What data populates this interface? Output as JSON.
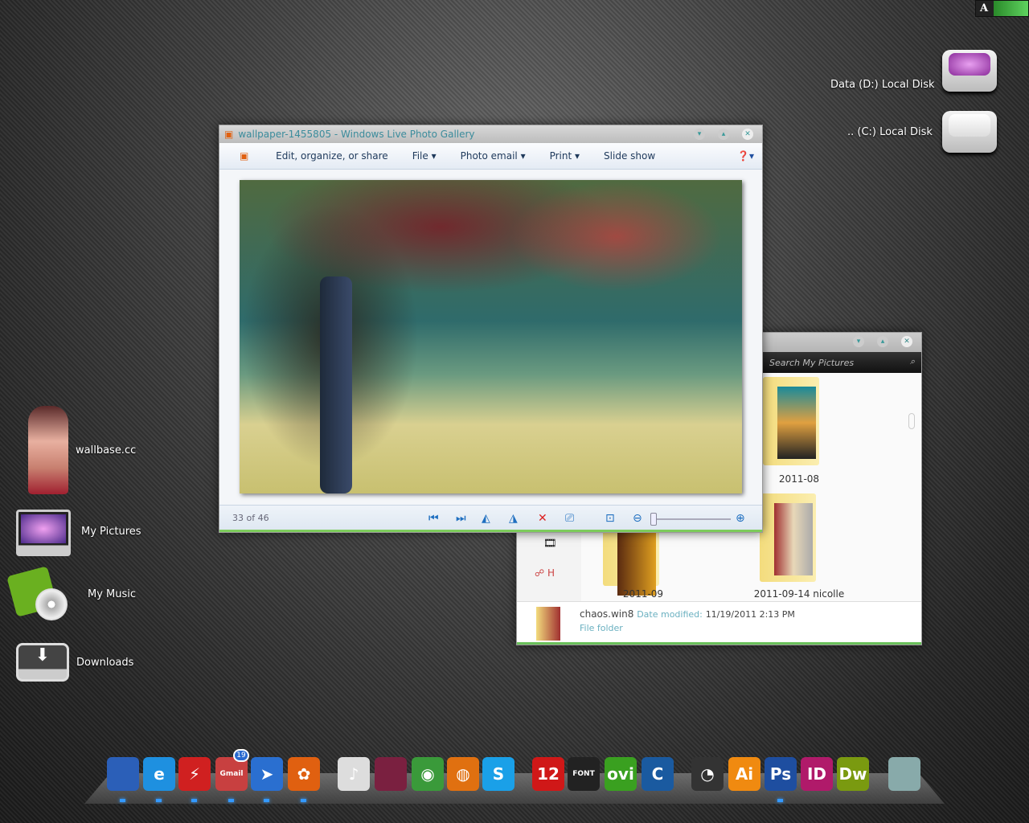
{
  "indicator": {
    "letter": "A",
    "color": "#4fc24f"
  },
  "desktop": {
    "right_icons": [
      {
        "label": "Data (D:) Local Disk",
        "icon": "drive-icon"
      },
      {
        "label": ".. (C:) Local Disk",
        "icon": "drive-icon"
      }
    ],
    "left_icons": [
      {
        "label": "wallbase.cc"
      },
      {
        "label": "My Pictures"
      },
      {
        "label": "My Music"
      },
      {
        "label": "Downloads"
      }
    ]
  },
  "photo_gallery": {
    "title": "wallpaper-1455805 - Windows Live Photo Gallery",
    "toolbar": [
      "Edit, organize, or share",
      "File ▾",
      "Photo email ▾",
      "Print ▾",
      "Slide show"
    ],
    "counter": "33 of 46",
    "zoom_level": 0.05
  },
  "explorer": {
    "search_placeholder": "Search My Pictures",
    "sidebar_partial": "H",
    "folders": [
      "2011-08",
      "2011-09",
      "2011-09-14 nicolle"
    ],
    "details": {
      "name": "chaos.win8",
      "date_label": "Date modified:",
      "date": "11/19/2011 2:13 PM",
      "type": "File folder"
    }
  },
  "dock": {
    "items": [
      {
        "name": "computer",
        "label": "",
        "color": "#2b5fb8"
      },
      {
        "name": "internet-explorer",
        "label": "e",
        "color": "#1e90e0"
      },
      {
        "name": "flashget",
        "label": "⚡",
        "color": "#d02020"
      },
      {
        "name": "gmail",
        "label": "Gmail",
        "color": "#c84040",
        "badge": "19"
      },
      {
        "name": "bird-app",
        "label": "➤",
        "color": "#2a6fd0"
      },
      {
        "name": "photo-gallery",
        "label": "✿",
        "color": "#e06010"
      },
      {
        "name": "mp3",
        "label": "♪",
        "color": "#ddd"
      },
      {
        "name": "photo-frame",
        "label": "",
        "color": "#7a2040"
      },
      {
        "name": "chrome",
        "label": "◉",
        "color": "#3a9a3a"
      },
      {
        "name": "firefox",
        "label": "◍",
        "color": "#e07010"
      },
      {
        "name": "skype",
        "label": "S",
        "color": "#1aa0e8"
      },
      {
        "name": "calendar",
        "label": "12",
        "color": "#d01818"
      },
      {
        "name": "font-book",
        "label": "FONT",
        "color": "#222"
      },
      {
        "name": "ovi",
        "label": "ovi",
        "color": "#3aa020"
      },
      {
        "name": "ccleaner",
        "label": "C",
        "color": "#1a5aa0"
      },
      {
        "name": "picasa",
        "label": "◔",
        "color": "#333"
      },
      {
        "name": "illustrator",
        "label": "Ai",
        "color": "#f08a10"
      },
      {
        "name": "photoshop",
        "label": "Ps",
        "color": "#1e4ea0"
      },
      {
        "name": "indesign",
        "label": "ID",
        "color": "#b01a6a"
      },
      {
        "name": "dreamweaver",
        "label": "Dw",
        "color": "#7a9a10"
      },
      {
        "name": "recycle-bin",
        "label": "",
        "color": "#8aa"
      }
    ]
  }
}
